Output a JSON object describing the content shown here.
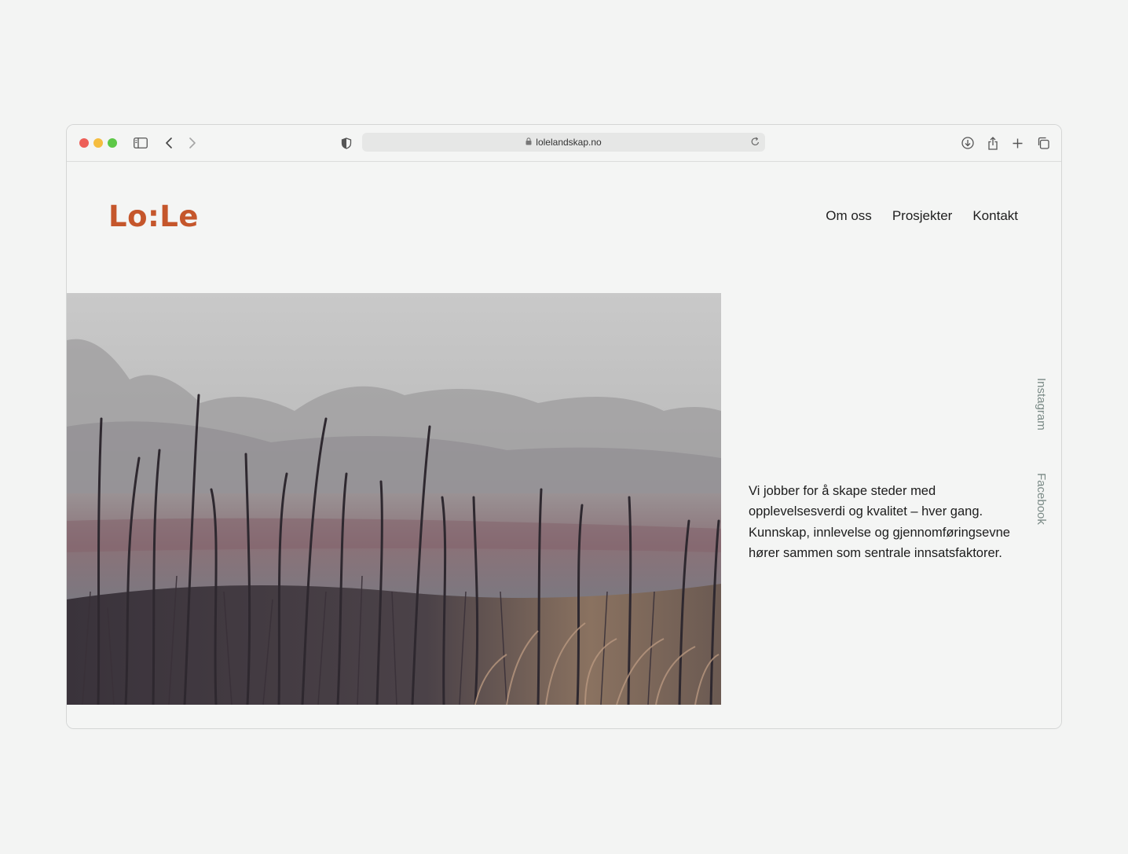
{
  "browser": {
    "url": "lolelandskap.no",
    "colors": {
      "red": "#ed5f58",
      "yellow": "#f5bd3f",
      "green": "#5dc847"
    },
    "icons": [
      "sidebar-icon",
      "back-icon",
      "forward-icon",
      "shield-icon",
      "lock-icon",
      "reload-icon",
      "download-icon",
      "share-icon",
      "new-tab-icon",
      "tabs-overview-icon"
    ]
  },
  "site": {
    "logo": "Lo:Le",
    "brand_color": "#c5562b",
    "nav": [
      {
        "label": "Om oss"
      },
      {
        "label": "Prosjekter"
      },
      {
        "label": "Kontakt"
      }
    ],
    "intro": "Vi jobber for å skape steder med opplevelsesverdi og kvalitet – hver gang. Kunnskap, innlevelse og gjennomføringsevne hører sammen som sentrale innsatsfaktorer.",
    "social": [
      {
        "label": "Instagram"
      },
      {
        "label": "Facebook"
      }
    ]
  }
}
